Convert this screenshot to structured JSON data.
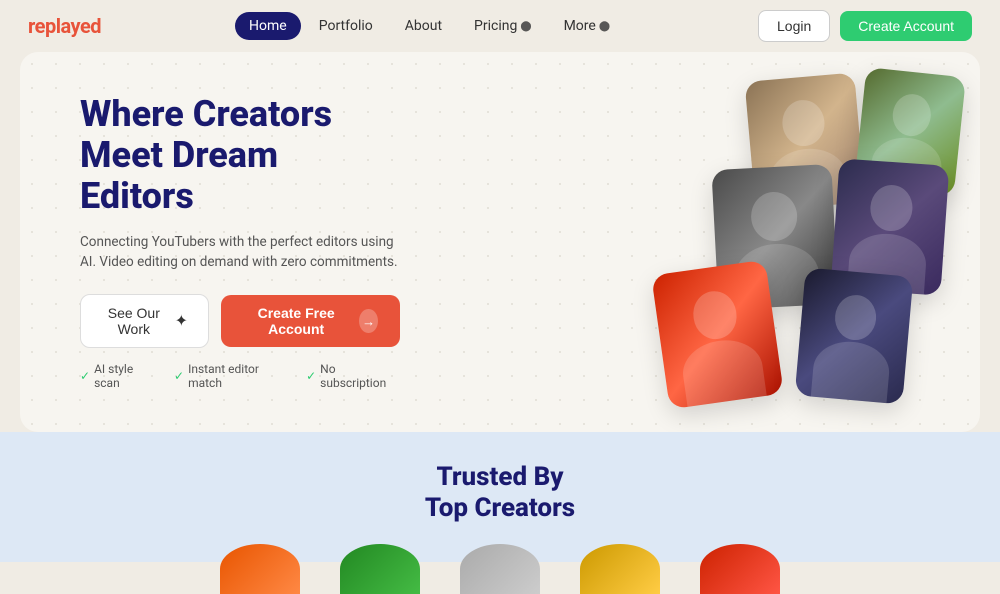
{
  "brand": {
    "name": "replayed",
    "color": "#e8533a"
  },
  "nav": {
    "links": [
      {
        "label": "Home",
        "active": true
      },
      {
        "label": "Portfolio",
        "active": false
      },
      {
        "label": "About",
        "active": false
      },
      {
        "label": "Pricing",
        "active": false,
        "hasDropdown": true
      },
      {
        "label": "More",
        "active": false,
        "hasDropdown": true
      }
    ],
    "login_label": "Login",
    "create_account_label": "Create Account"
  },
  "hero": {
    "title": "Where Creators Meet Dream Editors",
    "subtitle": "Connecting YouTubers with the perfect editors using AI. Video editing on demand with zero commitments.",
    "btn_see_work": "See Our Work",
    "btn_create_account": "Create Free Account",
    "features": [
      {
        "label": "AI style scan"
      },
      {
        "label": "Instant editor match"
      },
      {
        "label": "No subscription"
      }
    ]
  },
  "trusted": {
    "title": "Trusted By\nTop Creators"
  }
}
